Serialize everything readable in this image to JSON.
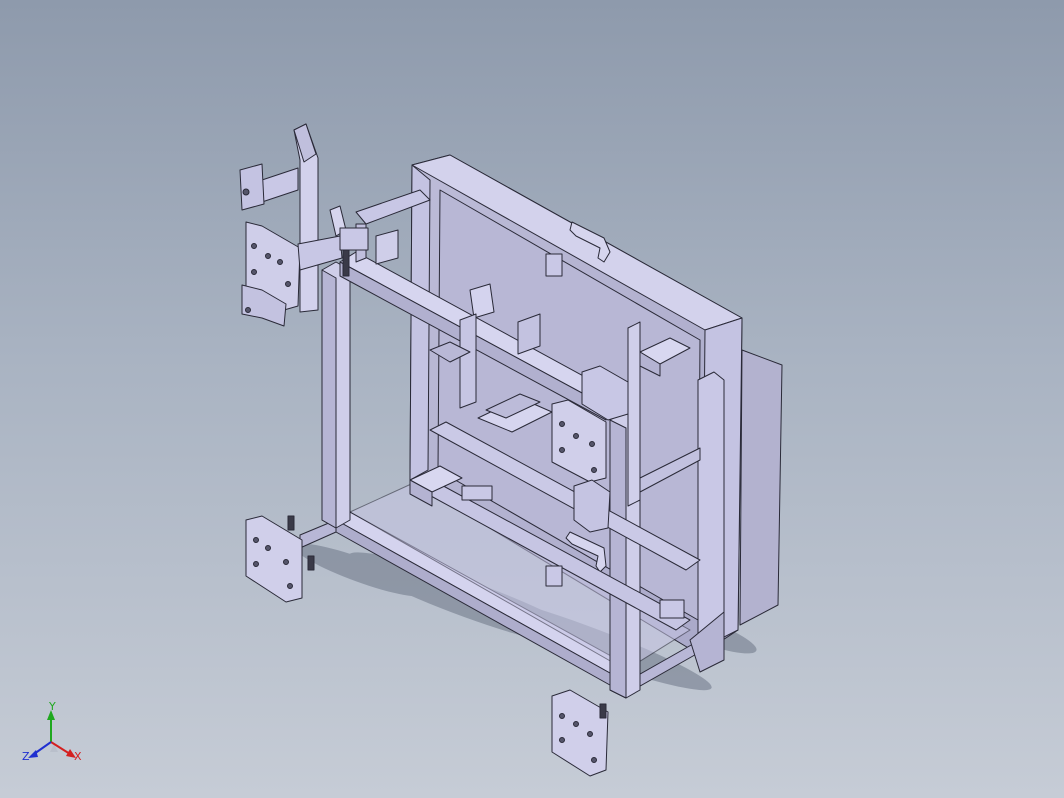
{
  "viewport": {
    "background_top": "#8e9aac",
    "background_bottom": "#c6ccd6",
    "part_fill": "#c9c8e6",
    "part_stroke": "#2a2a38",
    "shadow_color": "#6d7687"
  },
  "triad": {
    "x_label": "X",
    "y_label": "Y",
    "z_label": "Z",
    "x_color": "#d42020",
    "y_color": "#1fa81f",
    "z_color": "#2030d0"
  }
}
